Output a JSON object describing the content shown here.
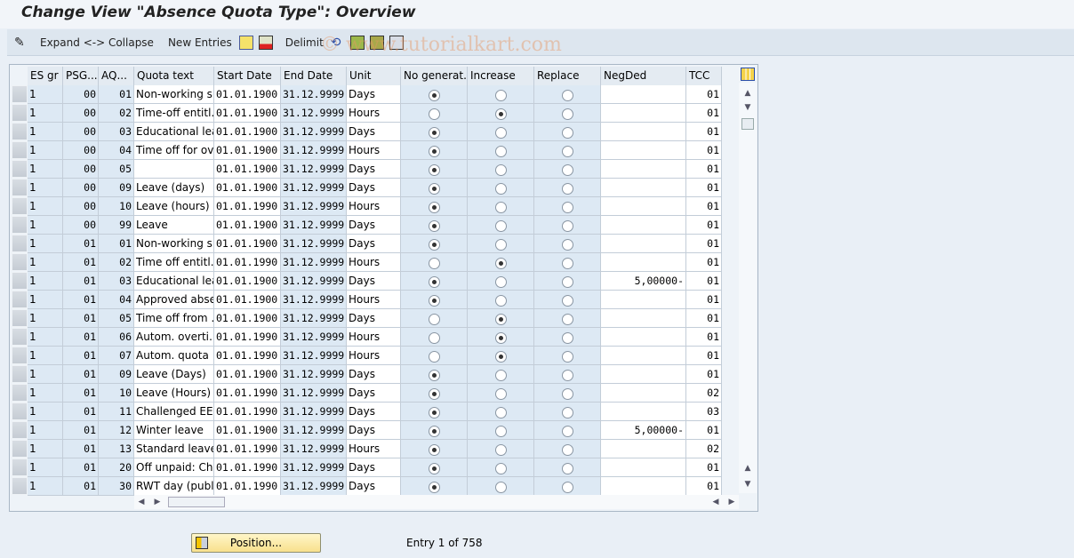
{
  "title": "Change View \"Absence Quota Type\": Overview",
  "toolbar": {
    "expand_collapse": "Expand <-> Collapse",
    "new_entries": "New Entries",
    "delimit": "Delimit"
  },
  "watermark": "© www.tutorialkart.com",
  "columns": [
    "ES gr",
    "PSG...",
    "AQ...",
    "Quota text",
    "Start Date",
    "End Date",
    "Unit",
    "No generat.",
    "Increase",
    "Replace",
    "NegDed",
    "TCC"
  ],
  "rows": [
    [
      "1",
      "00",
      "01",
      "Non-working s…",
      "01.01.1900",
      "31.12.9999",
      "Days",
      "N",
      "",
      "01"
    ],
    [
      "1",
      "00",
      "02",
      "Time-off entitl…",
      "01.01.1900",
      "31.12.9999",
      "Hours",
      "I",
      "",
      "01"
    ],
    [
      "1",
      "00",
      "03",
      "Educational lea…",
      "01.01.1900",
      "31.12.9999",
      "Days",
      "N",
      "",
      "01"
    ],
    [
      "1",
      "00",
      "04",
      "Time off for ov…",
      "01.01.1900",
      "31.12.9999",
      "Hours",
      "N",
      "",
      "01"
    ],
    [
      "1",
      "00",
      "05",
      "",
      "01.01.1900",
      "31.12.9999",
      "Days",
      "N",
      "",
      "01"
    ],
    [
      "1",
      "00",
      "09",
      "Leave (days)",
      "01.01.1900",
      "31.12.9999",
      "Days",
      "N",
      "",
      "01"
    ],
    [
      "1",
      "00",
      "10",
      "Leave (hours)",
      "01.01.1990",
      "31.12.9999",
      "Hours",
      "N",
      "",
      "01"
    ],
    [
      "1",
      "00",
      "99",
      "Leave",
      "01.01.1900",
      "31.12.9999",
      "Days",
      "N",
      "",
      "01"
    ],
    [
      "1",
      "01",
      "01",
      "Non-working s…",
      "01.01.1900",
      "31.12.9999",
      "Days",
      "N",
      "",
      "01"
    ],
    [
      "1",
      "01",
      "02",
      "Time off entitl…",
      "01.01.1990",
      "31.12.9999",
      "Hours",
      "I",
      "",
      "01"
    ],
    [
      "1",
      "01",
      "03",
      "Educational lea…",
      "01.01.1900",
      "31.12.9999",
      "Days",
      "N",
      "5,00000-",
      "01"
    ],
    [
      "1",
      "01",
      "04",
      "Approved abse…",
      "01.01.1900",
      "31.12.9999",
      "Hours",
      "N",
      "",
      "01"
    ],
    [
      "1",
      "01",
      "05",
      "Time off from …",
      "01.01.1900",
      "31.12.9999",
      "Days",
      "I",
      "",
      "01"
    ],
    [
      "1",
      "01",
      "06",
      "Autom. overti…",
      "01.01.1990",
      "31.12.9999",
      "Hours",
      "I",
      "",
      "01"
    ],
    [
      "1",
      "01",
      "07",
      "Autom. quota …",
      "01.01.1990",
      "31.12.9999",
      "Hours",
      "I",
      "",
      "01"
    ],
    [
      "1",
      "01",
      "09",
      "Leave (Days)",
      "01.01.1900",
      "31.12.9999",
      "Days",
      "N",
      "",
      "01"
    ],
    [
      "1",
      "01",
      "10",
      "Leave (Hours)",
      "01.01.1990",
      "31.12.9999",
      "Days",
      "N",
      "",
      "02"
    ],
    [
      "1",
      "01",
      "11",
      "Challenged EE …",
      "01.01.1990",
      "31.12.9999",
      "Days",
      "N",
      "",
      "03"
    ],
    [
      "1",
      "01",
      "12",
      "Winter leave",
      "01.01.1900",
      "31.12.9999",
      "Days",
      "N",
      "5,00000-",
      "01"
    ],
    [
      "1",
      "01",
      "13",
      "Standard leave",
      "01.01.1990",
      "31.12.9999",
      "Hours",
      "N",
      "",
      "02"
    ],
    [
      "1",
      "01",
      "20",
      "Off unpaid: Chi…",
      "01.01.1990",
      "31.12.9999",
      "Days",
      "N",
      "",
      "01"
    ],
    [
      "1",
      "01",
      "30",
      "RWT day (publ…",
      "01.01.1990",
      "31.12.9999",
      "Days",
      "N",
      "",
      "01"
    ]
  ],
  "footer": {
    "position_button": "Position...",
    "entry_text": "Entry 1 of 758"
  }
}
